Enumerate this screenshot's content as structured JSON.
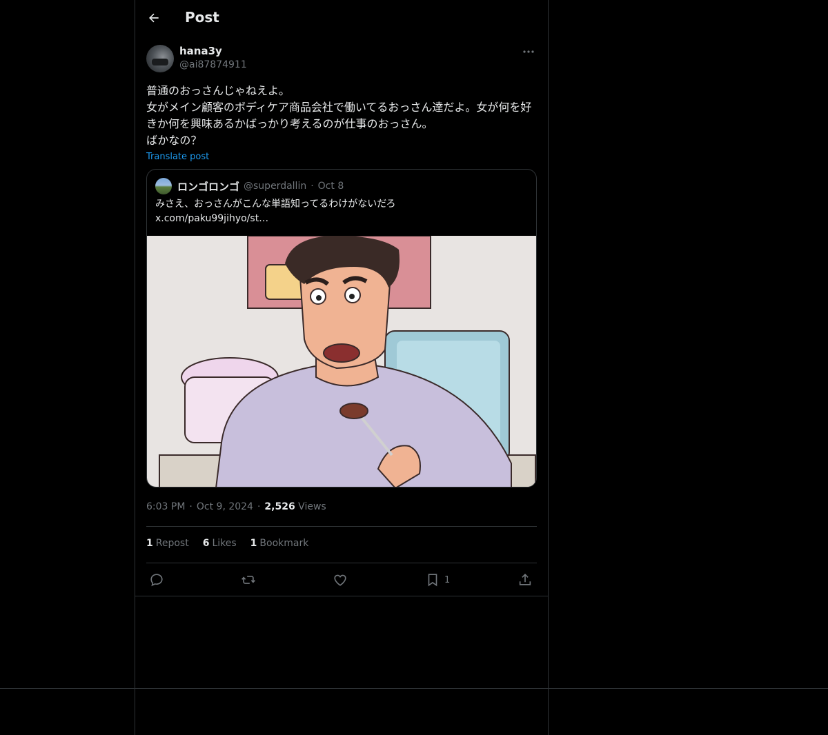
{
  "header": {
    "title": "Post"
  },
  "post": {
    "author_name": "hana3y",
    "author_handle": "@ai87874911",
    "text": "普通のおっさんじゃねえよ。\n女がメイン顧客のボディケア商品会社で働いてるおっさん達だよ。女が何を好きか何を興味あるかばっかり考えるのが仕事のおっさん。\nばかなの？",
    "translate_label": "Translate post",
    "quote": {
      "name": "ロンゴロンゴ",
      "handle": "@superdallin",
      "dot": "·",
      "date": "Oct 8",
      "text": "みさえ、おっさんがこんな単語知ってるわけがないだろ\nx.com/paku99jihyo/st…"
    },
    "time": "6:03 PM",
    "sep": "·",
    "date": "Oct 9, 2024",
    "views_count": "2,526",
    "views_label": "Views",
    "stats": {
      "reposts_count": "1",
      "reposts_label": "Repost",
      "likes_count": "6",
      "likes_label": "Likes",
      "bookmarks_count": "1",
      "bookmarks_label": "Bookmark"
    },
    "actions": {
      "bookmark_count": "1"
    }
  },
  "colors": {
    "background": "#000000",
    "text": "#e7e9ea",
    "muted": "#71767b",
    "accent": "#1d9bf0",
    "border": "#2f3336"
  },
  "icons": [
    "back-arrow-icon",
    "more-icon",
    "reply-icon",
    "repost-icon",
    "like-icon",
    "bookmark-icon",
    "share-icon"
  ]
}
